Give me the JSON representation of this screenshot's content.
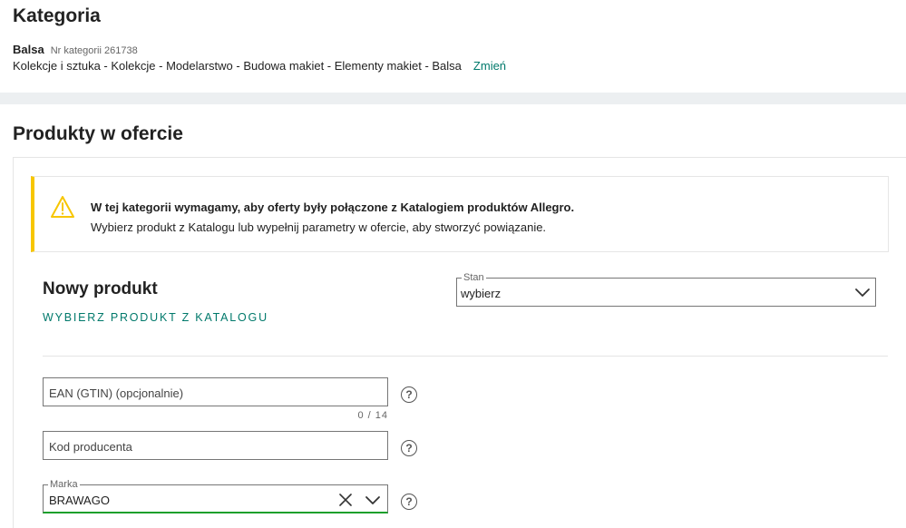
{
  "category": {
    "title": "Kategoria",
    "name": "Balsa",
    "number_label": "Nr kategorii 261738",
    "path": "Kolekcje i sztuka - Kolekcje - Modelarstwo - Budowa makiet - Elementy makiet - Balsa",
    "change_link": "Zmień"
  },
  "products": {
    "title": "Produkty w ofercie",
    "alert": {
      "icon": "warning-triangle-icon",
      "bold": "W tej kategorii wymagamy, aby oferty były połączone z Katalogiem produktów Allegro.",
      "text": "Wybierz produkt z Katalogu lub wypełnij parametry w ofercie, aby stworzyć powiązanie."
    },
    "new_product": {
      "title": "Nowy produkt",
      "catalog_link": "WYBIERZ PRODUKT Z KATALOGU"
    },
    "stan": {
      "label": "Stan",
      "value": "wybierz"
    },
    "ean": {
      "placeholder": "EAN (GTIN) (opcjonalnie)",
      "counter": "0 / 14"
    },
    "kod": {
      "placeholder": "Kod producenta"
    },
    "marka": {
      "label": "Marka",
      "value": "BRAWAGO"
    },
    "help_symbol": "?"
  },
  "colors": {
    "accent": "#00796b",
    "warning": "#f7c600",
    "valid": "#1a9f2b"
  }
}
